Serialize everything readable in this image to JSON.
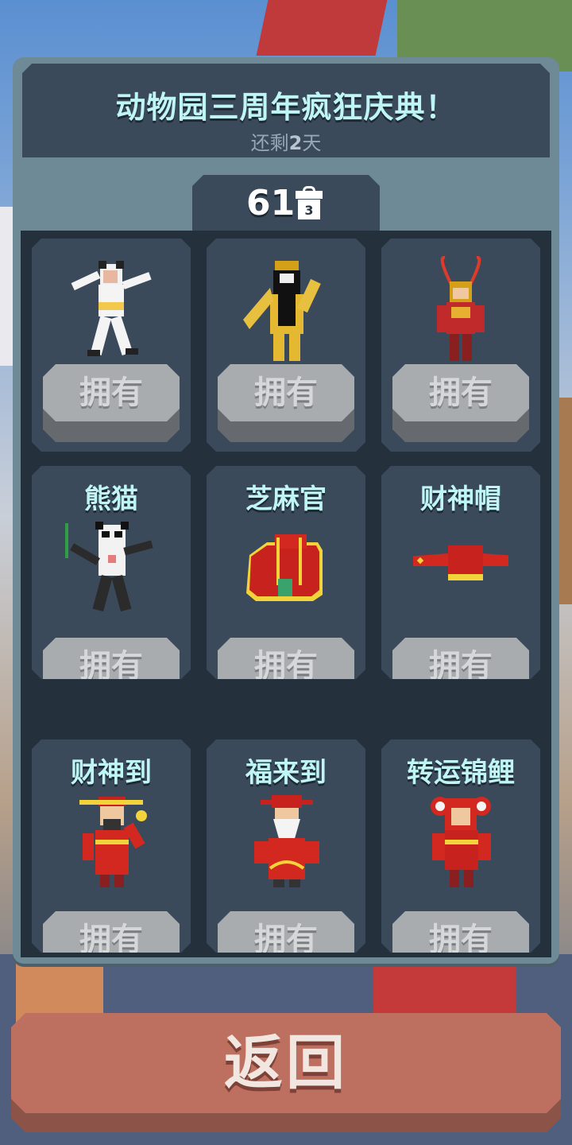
{
  "event": {
    "title": "动物园三周年疯狂庆典！",
    "remaining_prefix": "还剩",
    "remaining_days": "2",
    "remaining_suffix": "天"
  },
  "counter": {
    "value": "61",
    "gift_icon": "gift-box-icon",
    "gift_number": "3"
  },
  "items": [
    {
      "title": "",
      "button": "拥有",
      "art": "cow-costume-icon"
    },
    {
      "title": "",
      "button": "拥有",
      "art": "opera-general-costume-icon"
    },
    {
      "title": "",
      "button": "拥有",
      "art": "monkey-king-costume-icon"
    },
    {
      "title": "熊猫",
      "button": "拥有",
      "art": "panda-costume-icon"
    },
    {
      "title": "芝麻官",
      "button": "拥有",
      "art": "official-hat-icon"
    },
    {
      "title": "财神帽",
      "button": "拥有",
      "art": "fortune-god-hat-icon"
    },
    {
      "title": "财神到",
      "button": "拥有",
      "art": "fortune-god-costume-icon"
    },
    {
      "title": "福来到",
      "button": "拥有",
      "art": "blessing-elder-costume-icon"
    },
    {
      "title": "转运锦鲤",
      "button": "拥有",
      "art": "lucky-koi-costume-icon"
    }
  ],
  "back_button": "返回",
  "colors": {
    "panel": "#6f8a97",
    "header": "#3a4a5a",
    "title_text": "#bff6f5",
    "owned_button": "#a9acaf",
    "back_button": "#bd705f"
  }
}
